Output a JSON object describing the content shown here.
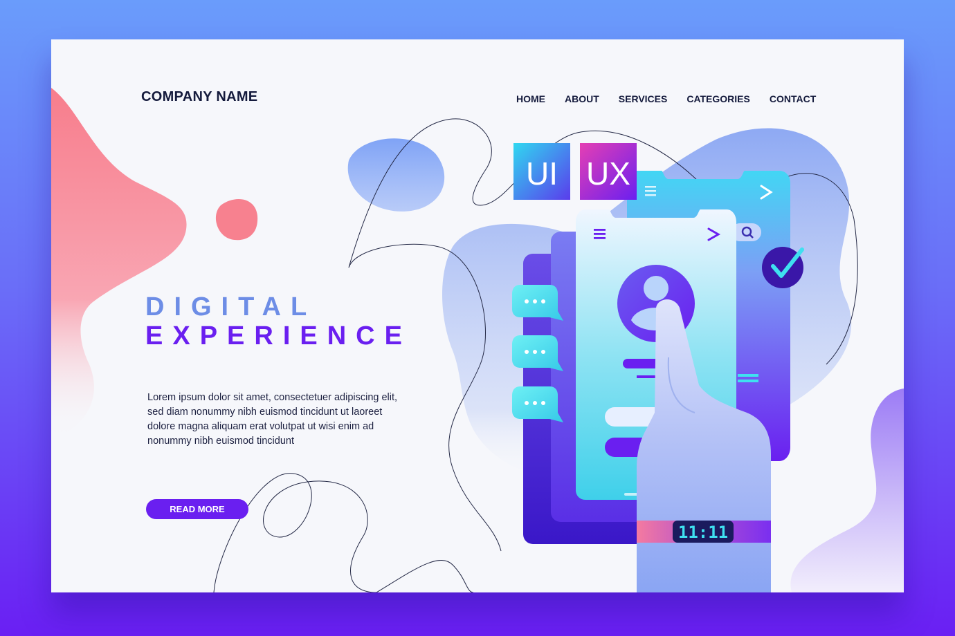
{
  "header": {
    "company_name": "COMPANY NAME",
    "nav": [
      "HOME",
      "ABOUT",
      "SERVICES",
      "CATEGORIES",
      "CONTACT"
    ]
  },
  "hero": {
    "title_line1": "DIGITAL",
    "title_line2": "EXPERIENCE",
    "body": "Lorem ipsum dolor sit amet, consectetuer adipiscing elit, sed diam nonummy nibh euismod tincidunt ut laoreet dolore magna aliquam erat volutpat ut wisi enim ad nonummy nibh euismod tincidunt",
    "button_label": "READ MORE"
  },
  "illustration": {
    "tile_ui": "UI",
    "tile_ux": "UX",
    "watch_time": "11:11"
  },
  "colors": {
    "accent": "#6a1ff0",
    "title_light": "#6d8de6",
    "coral": "#f7818f",
    "cyan": "#3fe0f0",
    "text": "#141a3c"
  }
}
